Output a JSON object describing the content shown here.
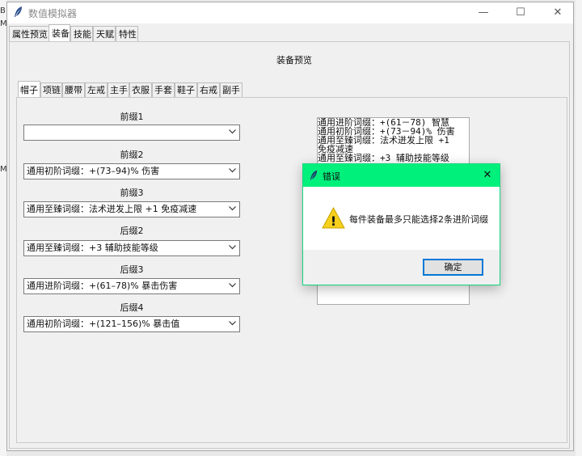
{
  "window": {
    "title": "数值模拟器",
    "min_glyph": "—",
    "max_glyph": "☐",
    "close_glyph": "✕"
  },
  "background": {
    "fragment1": "B",
    "fragment2": "M",
    "fragment3": "M"
  },
  "main_tabs": [
    {
      "label": "属性预览"
    },
    {
      "label": "装备"
    },
    {
      "label": "技能"
    },
    {
      "label": "天赋"
    },
    {
      "label": "特性"
    }
  ],
  "section_title": "装备预览",
  "equip_tabs": [
    {
      "label": "帽子"
    },
    {
      "label": "项链"
    },
    {
      "label": "腰带"
    },
    {
      "label": "左戒"
    },
    {
      "label": "主手"
    },
    {
      "label": "衣服"
    },
    {
      "label": "手套"
    },
    {
      "label": "鞋子"
    },
    {
      "label": "右戒"
    },
    {
      "label": "副手"
    }
  ],
  "fields": [
    {
      "label": "前缀1",
      "value": ""
    },
    {
      "label": "前缀2",
      "value": "通用初阶词缀：+(73–94)% 伤害"
    },
    {
      "label": "前缀3",
      "value": "通用至臻词缀：法术迸发上限 +1 免疫减速"
    },
    {
      "label": "后缀2",
      "value": "通用至臻词缀：+3 辅助技能等级"
    },
    {
      "label": "后缀3",
      "value": "通用进阶词缀：+(61–78)% 暴击伤害"
    },
    {
      "label": "后缀4",
      "value": "通用初阶词缀：+(121–156)% 暴击值"
    }
  ],
  "preview_lines": [
    "通用进阶词缀：+(61－78) 智慧",
    "通用初阶词缀：+(73－94)% 伤害",
    "通用至臻词缀：法术迸发上限 +1",
    "免疫减速",
    "通用至臻词缀：+3 辅助技能等级"
  ],
  "dialog": {
    "title": "错误",
    "message": "每件装备最多只能选择2条进阶词缀",
    "ok_label": "确定",
    "close_glyph": "✕",
    "warning_glyph": "!"
  },
  "colors": {
    "dialog_titlebar": "#00f07c",
    "focus_border": "#0078d7"
  }
}
